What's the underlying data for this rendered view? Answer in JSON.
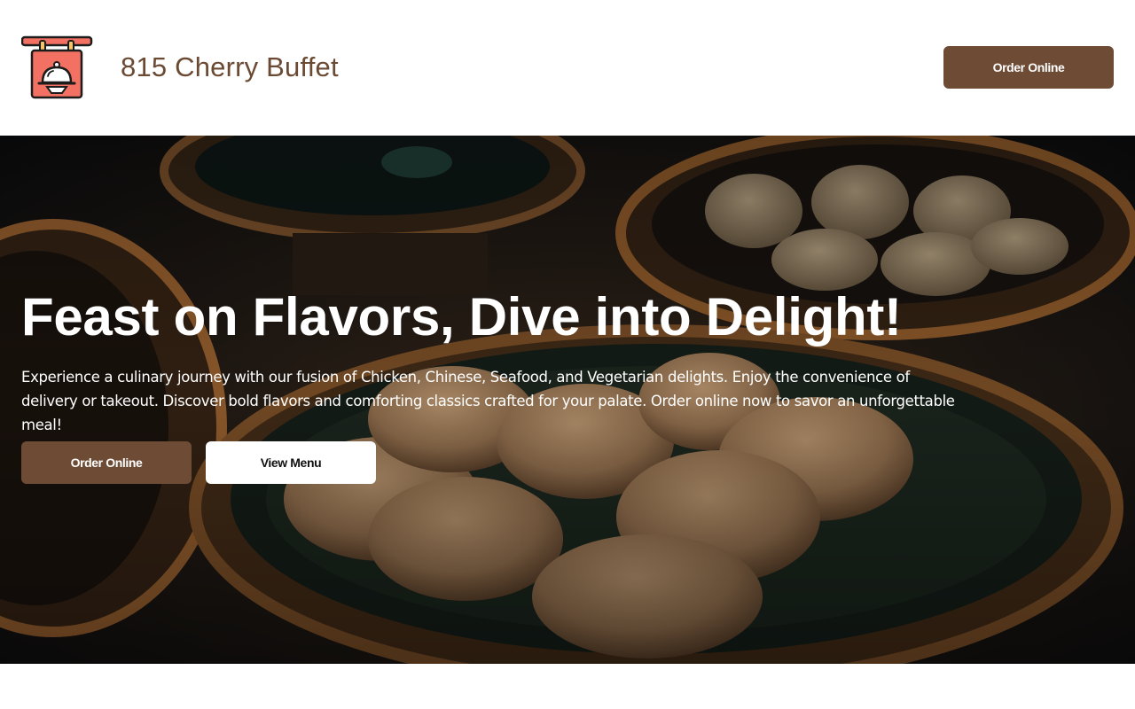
{
  "header": {
    "logo_icon": "restaurant-sign-cloche-icon",
    "brand_name": "815 Cherry Buffet",
    "order_button": "Order Online"
  },
  "hero": {
    "background": "steamed-dumplings-photo",
    "title": "Feast on Flavors, Dive into Delight!",
    "description": "Experience a culinary journey with our fusion of Chicken, Chinese, Seafood, and Vegetarian delights. Enjoy the convenience of delivery or takeout. Discover bold flavors and comforting classics crafted for your palate. Order online now to savor an unforgettable meal!",
    "order_button": "Order Online",
    "menu_button": "View Menu"
  },
  "colors": {
    "brand_brown": "#6e4b34",
    "brand_text": "#6b4a34",
    "logo_coral": "#f27163"
  }
}
